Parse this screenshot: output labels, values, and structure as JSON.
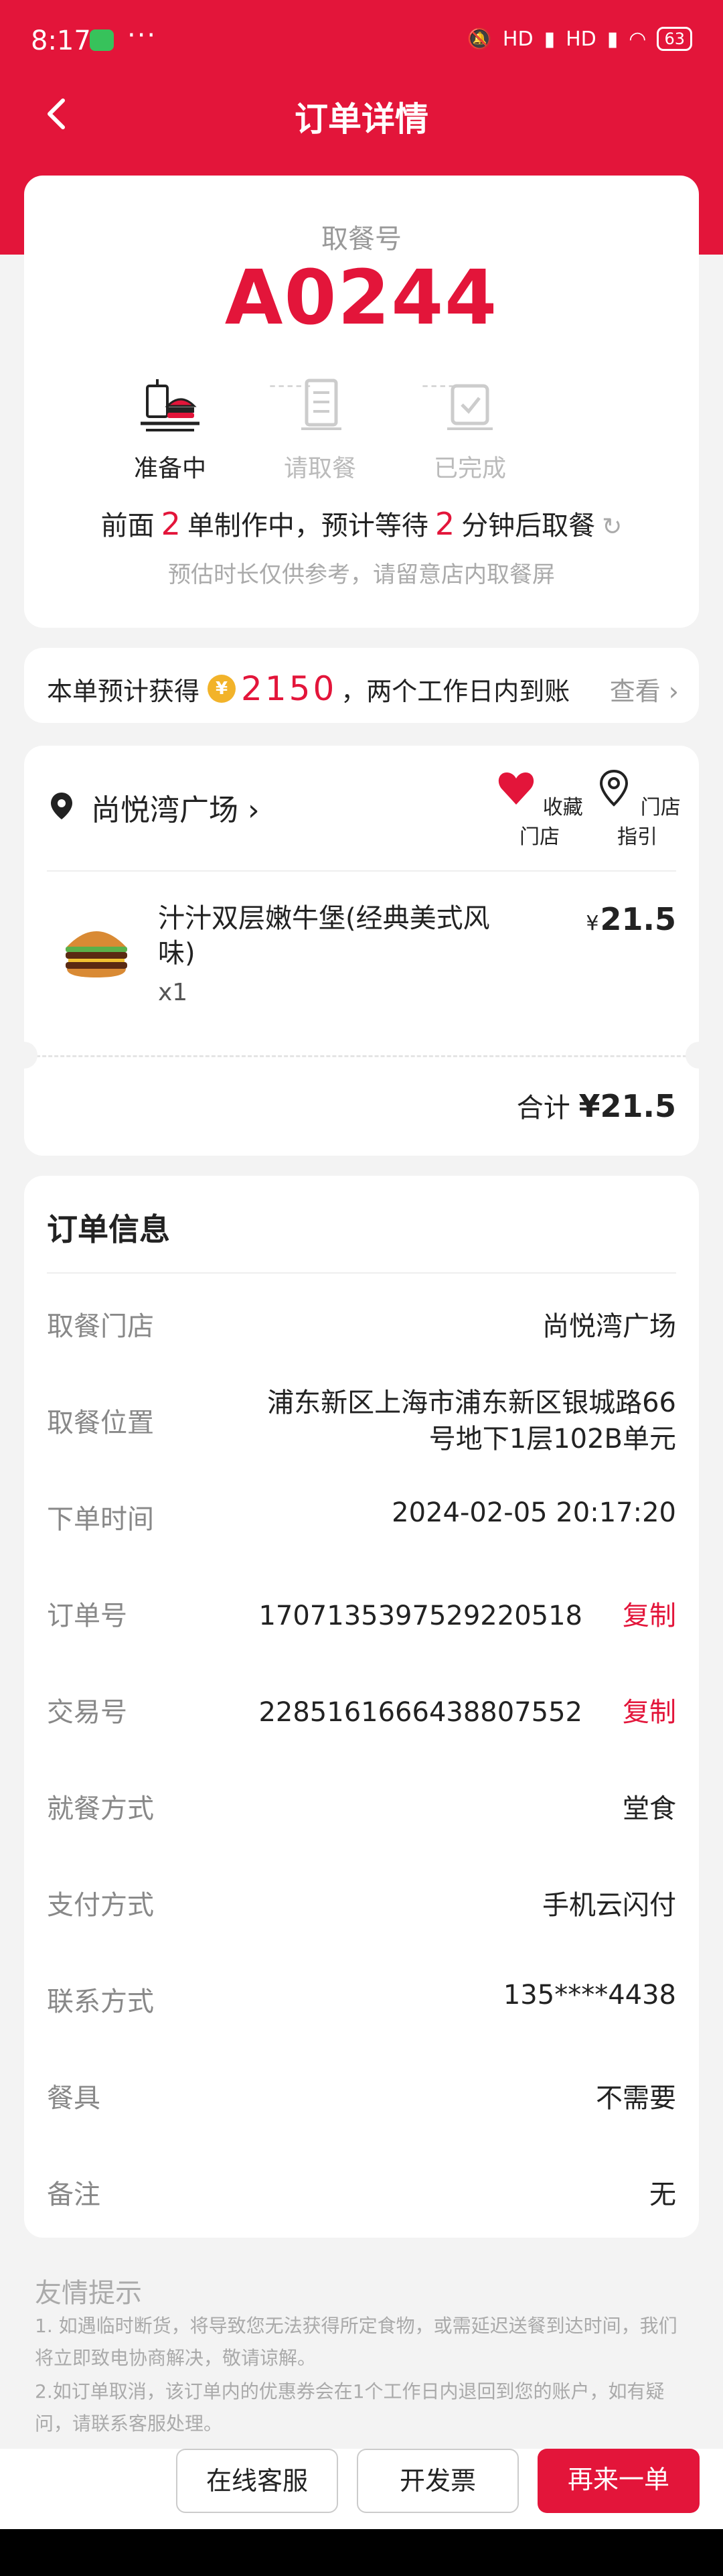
{
  "status": {
    "time": "8:17",
    "more": "···",
    "signal1": "HD",
    "signal2": "HD",
    "battery": "63"
  },
  "nav": {
    "title": "订单详情"
  },
  "pickup": {
    "label": "取餐号",
    "number": "A0244",
    "steps": [
      {
        "label": "准备中",
        "active": true,
        "icon": "food-tray-icon"
      },
      {
        "label": "请取餐",
        "active": false,
        "icon": "receipt-icon"
      },
      {
        "label": "已完成",
        "active": false,
        "icon": "checkmark-bag-icon"
      }
    ],
    "wait_prefix": "前面",
    "wait_count": "2",
    "wait_middle": "单制作中，预计等待",
    "wait_minutes": "2",
    "wait_suffix": "分钟后取餐",
    "note": "预估时长仅供参考，请留意店内取餐屏"
  },
  "earn": {
    "prefix": "本单预计获得",
    "coin_symbol": "¥",
    "amount": "2150",
    "suffix": "，两个工作日内到账",
    "view": "查看"
  },
  "store": {
    "name": "尚悦湾广场",
    "favorite": "收藏门店",
    "directions": "门店指引",
    "item_name": "汁汁双层嫩牛堡(经典美式风味)",
    "item_qty": "x1",
    "item_currency": "¥",
    "item_price": "21.5",
    "total_label": "合计",
    "total_value": "¥21.5"
  },
  "info": {
    "title": "订单信息",
    "rows": [
      {
        "key": "取餐门店",
        "value": "尚悦湾广场"
      },
      {
        "key": "取餐位置",
        "value1": "浦东新区上海市浦东新区银城路66",
        "value2": "号地下1层102B单元"
      },
      {
        "key": "下单时间",
        "value": "2024-02-05 20:17:20"
      },
      {
        "key": "订单号",
        "value": "1707135397529220518",
        "action": "复制"
      },
      {
        "key": "交易号",
        "value": "2285161666438807552",
        "action": "复制"
      },
      {
        "key": "就餐方式",
        "value": "堂食"
      },
      {
        "key": "支付方式",
        "value": "手机云闪付"
      },
      {
        "key": "联系方式",
        "value": "135****4438"
      },
      {
        "key": "餐具",
        "value": "不需要"
      },
      {
        "key": "备注",
        "value": "无"
      }
    ]
  },
  "tips": {
    "title": "友情提示",
    "line1a": "1. 如遇临时断货，将导致您无法获得所定食物，或需延迟送餐到达时间，我们",
    "line1b": "将立即致电协商解决，敬请谅解。",
    "line2a": "2.如订单取消，该订单内的优惠券会在1个工作日内退回到您的账户，如有疑",
    "line2b": "问，请联系客服处理。"
  },
  "actions": {
    "service": "在线客服",
    "invoice": "开发票",
    "reorder": "再来一单"
  },
  "colors": {
    "brand": "#e3153a",
    "background": "#f3f3f3"
  }
}
